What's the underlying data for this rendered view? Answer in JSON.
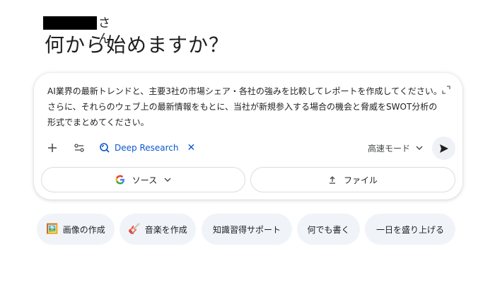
{
  "greeting": {
    "name_redacted": true,
    "suffix": "さん"
  },
  "title": "何から始めますか？",
  "prompt": {
    "text": "AI業界の最新トレンドと、主要3社の市場シェア・各社の強みを比較してレポートを作成してください。さらに、それらのウェブ上の最新情報をもとに、当社が新規参入する場合の機会と脅威をSWOT分析の形式でまとめてください。"
  },
  "toolbar": {
    "add_icon": "plus-icon",
    "tools_icon": "tune-icon",
    "deep_research_label": "Deep Research",
    "mode_label": "高速モード",
    "send_icon": "send-icon"
  },
  "actions": {
    "source_label": "ソース",
    "file_label": "ファイル"
  },
  "suggestions": [
    {
      "icon": "🖼️",
      "label": "画像の作成"
    },
    {
      "icon": "🎸",
      "label": "音楽を作成"
    },
    {
      "label": "知識習得サポート"
    },
    {
      "label": "何でも書く"
    },
    {
      "label": "一日を盛り上げる"
    }
  ],
  "colors": {
    "accent": "#0b57d0",
    "chip_bg": "#f0f4f9",
    "text": "#1f1f1f"
  }
}
